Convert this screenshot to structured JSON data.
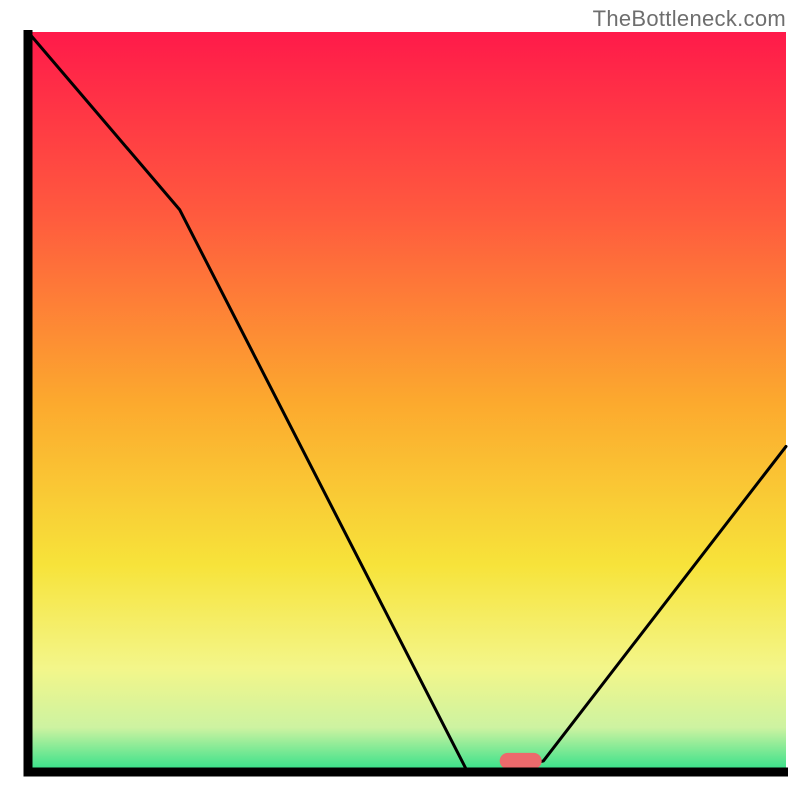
{
  "watermark": "TheBottleneck.com",
  "chart_data": {
    "type": "line",
    "title": "",
    "xlabel": "",
    "ylabel": "",
    "xlim": [
      0,
      100
    ],
    "ylim": [
      0,
      100
    ],
    "x": [
      0,
      20,
      58,
      62,
      68,
      100
    ],
    "values": [
      100,
      76,
      0,
      0,
      1.5,
      44
    ],
    "grid": false,
    "marker": {
      "x": 65,
      "y": 1.5,
      "color": "#ec6a6c"
    },
    "gradient_stops": [
      {
        "pct": 0,
        "color": "#ff1a4a"
      },
      {
        "pct": 25,
        "color": "#ff5b3e"
      },
      {
        "pct": 50,
        "color": "#fca92e"
      },
      {
        "pct": 72,
        "color": "#f7e33a"
      },
      {
        "pct": 86,
        "color": "#f3f68a"
      },
      {
        "pct": 94,
        "color": "#cdf3a1"
      },
      {
        "pct": 100,
        "color": "#2fe089"
      }
    ],
    "axis_color": "#000000",
    "line_color": "#000000"
  }
}
